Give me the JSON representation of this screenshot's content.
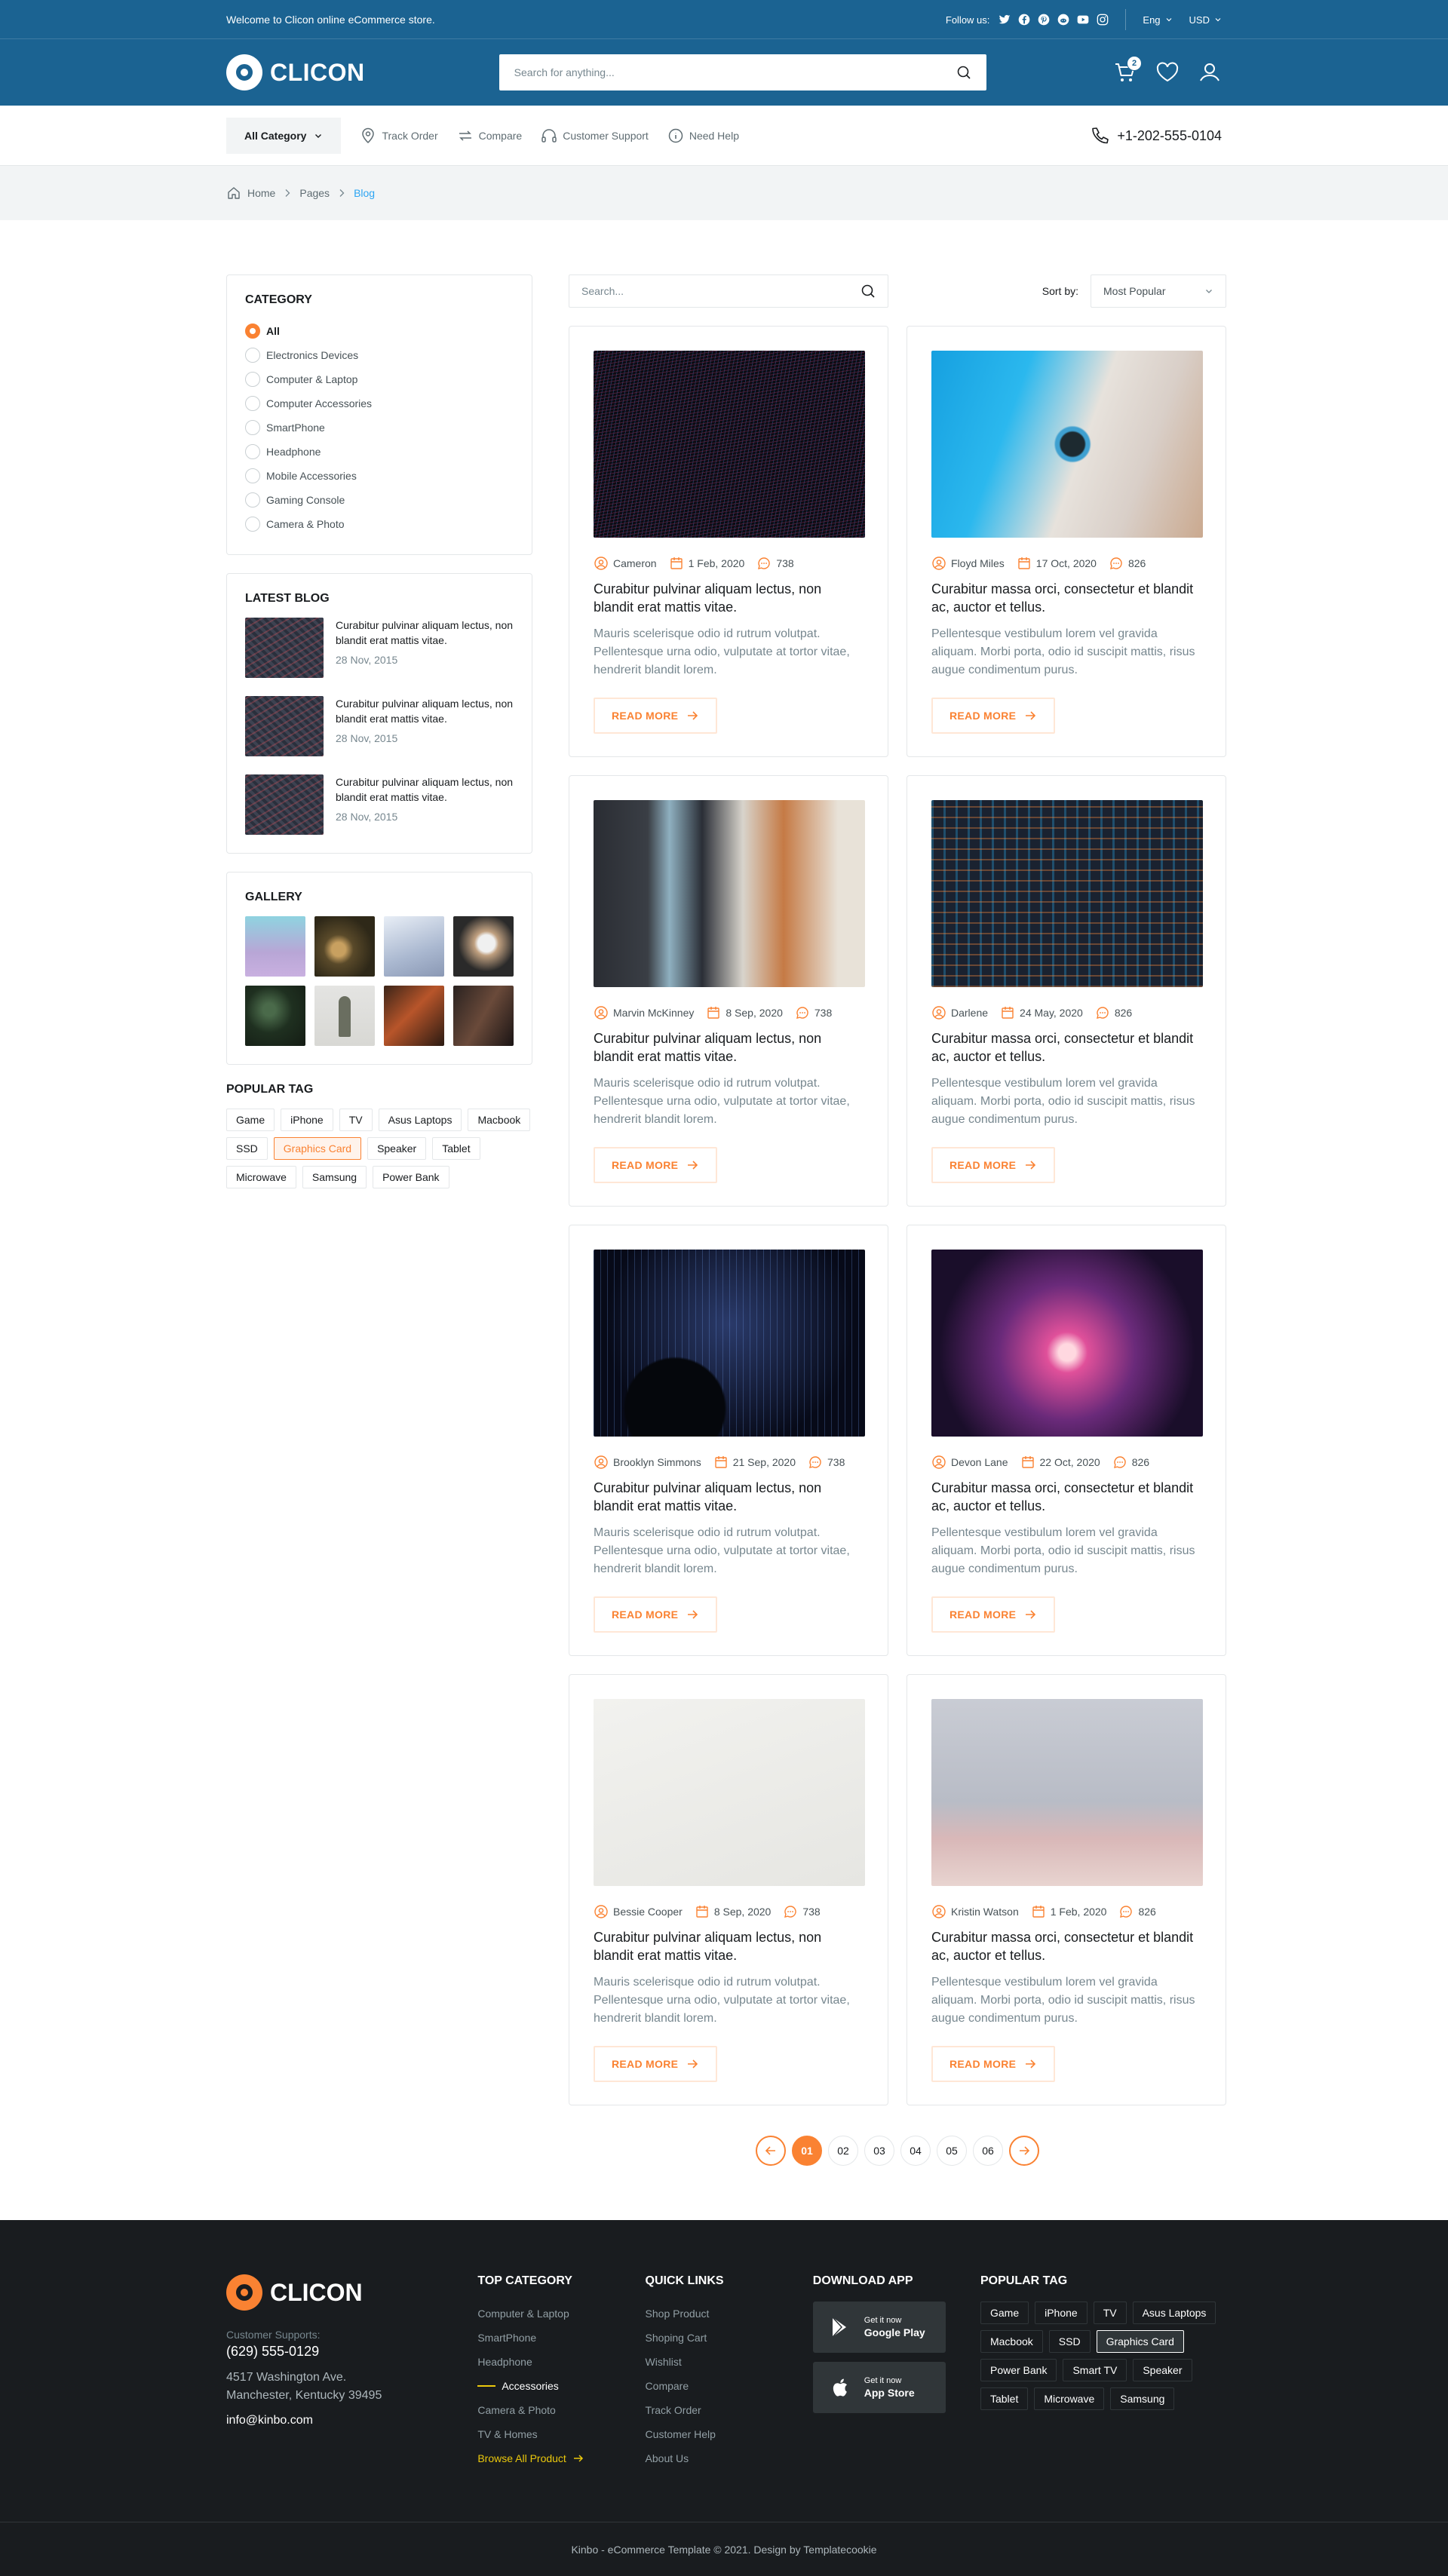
{
  "topbar": {
    "welcome": "Welcome to Clicon online eCommerce store.",
    "follow": "Follow us:",
    "social_icons": [
      "twitter-icon",
      "facebook-icon",
      "pinterest-icon",
      "reddit-icon",
      "youtube-icon",
      "instagram-icon"
    ],
    "language": "Eng",
    "currency": "USD"
  },
  "header": {
    "brand": "CLICON",
    "search_placeholder": "Search for anything...",
    "cart_count": "2"
  },
  "nav": {
    "all_category": "All Category",
    "items": [
      "Track Order",
      "Compare",
      "Customer Support",
      "Need Help"
    ],
    "phone": "+1-202-555-0104"
  },
  "breadcrumb": [
    "Home",
    "Pages",
    "Blog"
  ],
  "sidebar": {
    "category_title": "CATEGORY",
    "categories": [
      "All",
      "Electronics Devices",
      "Computer & Laptop",
      "Computer Accessories",
      "SmartPhone",
      "Headphone",
      "Mobile Accessories",
      "Gaming Console",
      "Camera & Photo"
    ],
    "selected_category": "All",
    "latest_title": "LATEST BLOG",
    "latest": [
      {
        "title": "Curabitur pulvinar aliquam lectus, non blandit erat mattis vitae.",
        "date": "28 Nov, 2015"
      },
      {
        "title": "Curabitur pulvinar aliquam lectus, non blandit erat mattis vitae.",
        "date": "28 Nov, 2015"
      },
      {
        "title": "Curabitur pulvinar aliquam lectus, non blandit erat mattis vitae.",
        "date": "28 Nov, 2015"
      }
    ],
    "gallery_title": "GALLERY",
    "tags_title": "POPULAR TAG",
    "tags": [
      "Game",
      "iPhone",
      "TV",
      "Asus Laptops",
      "Macbook",
      "SSD",
      "Graphics Card",
      "Speaker",
      "Tablet",
      "Microwave",
      "Samsung",
      "Power Bank"
    ],
    "active_tag": "Graphics Card"
  },
  "content": {
    "search_placeholder": "Search...",
    "sort_label": "Sort by:",
    "sort_value": "Most Popular",
    "read_more": "READ MORE",
    "posts": [
      {
        "author": "Cameron",
        "date": "1 Feb, 2020",
        "comments": "738",
        "title": "Curabitur pulvinar aliquam lectus, non blandit erat mattis vitae.",
        "desc": "Mauris scelerisque odio id rutrum volutpat. Pellentesque urna odio, vulputate at tortor vitae, hendrerit blandit lorem."
      },
      {
        "author": "Floyd Miles",
        "date": "17 Oct, 2020",
        "comments": "826",
        "title": "Curabitur massa orci, consectetur et blandit ac, auctor et tellus.",
        "desc": "Pellentesque vestibulum lorem vel gravida aliquam. Morbi porta, odio id suscipit mattis, risus augue condimentum purus."
      },
      {
        "author": "Marvin McKinney",
        "date": "8 Sep, 2020",
        "comments": "738",
        "title": "Curabitur pulvinar aliquam lectus, non blandit erat mattis vitae.",
        "desc": "Mauris scelerisque odio id rutrum volutpat. Pellentesque urna odio, vulputate at tortor vitae, hendrerit blandit lorem."
      },
      {
        "author": "Darlene",
        "date": "24 May, 2020",
        "comments": "826",
        "title": "Curabitur massa orci, consectetur et blandit ac, auctor et tellus.",
        "desc": "Pellentesque vestibulum lorem vel gravida aliquam. Morbi porta, odio id suscipit mattis, risus augue condimentum purus."
      },
      {
        "author": "Brooklyn Simmons",
        "date": "21 Sep, 2020",
        "comments": "738",
        "title": "Curabitur pulvinar aliquam lectus, non blandit erat mattis vitae.",
        "desc": "Mauris scelerisque odio id rutrum volutpat. Pellentesque urna odio, vulputate at tortor vitae, hendrerit blandit lorem."
      },
      {
        "author": "Devon Lane",
        "date": "22 Oct, 2020",
        "comments": "826",
        "title": "Curabitur massa orci, consectetur et blandit ac, auctor et tellus.",
        "desc": "Pellentesque vestibulum lorem vel gravida aliquam. Morbi porta, odio id suscipit mattis, risus augue condimentum purus."
      },
      {
        "author": "Bessie Cooper",
        "date": "8 Sep, 2020",
        "comments": "738",
        "title": "Curabitur pulvinar aliquam lectus, non blandit erat mattis vitae.",
        "desc": "Mauris scelerisque odio id rutrum volutpat. Pellentesque urna odio, vulputate at tortor vitae, hendrerit blandit lorem."
      },
      {
        "author": "Kristin Watson",
        "date": "1 Feb, 2020",
        "comments": "826",
        "title": "Curabitur massa orci, consectetur et blandit ac, auctor et tellus.",
        "desc": "Pellentesque vestibulum lorem vel gravida aliquam. Morbi porta, odio id suscipit mattis, risus augue condimentum purus."
      }
    ],
    "pages": [
      "01",
      "02",
      "03",
      "04",
      "05",
      "06"
    ],
    "current_page": "01"
  },
  "footer": {
    "brand": "CLICON",
    "support_label": "Customer Supports:",
    "phone": "(629) 555-0129",
    "address": "4517 Washington Ave. Manchester, Kentucky 39495",
    "email": "info@kinbo.com",
    "top_category_title": "TOP CATEGORY",
    "top_category": [
      "Computer & Laptop",
      "SmartPhone",
      "Headphone",
      "Accessories",
      "Camera & Photo",
      "TV & Homes"
    ],
    "active_category": "Accessories",
    "browse": "Browse All Product",
    "quick_links_title": "QUICK LINKS",
    "quick_links": [
      "Shop Product",
      "Shoping Cart",
      "Wishlist",
      "Compare",
      "Track Order",
      "Customer Help",
      "About Us"
    ],
    "download_title": "DOWNLOAD APP",
    "apps": [
      {
        "small": "Get it now",
        "name": "Google Play"
      },
      {
        "small": "Get it now",
        "name": "App Store"
      }
    ],
    "tags_title": "POPULAR TAG",
    "tags": [
      "Game",
      "iPhone",
      "TV",
      "Asus Laptops",
      "Macbook",
      "SSD",
      "Graphics Card",
      "Power Bank",
      "Smart TV",
      "Speaker",
      "Tablet",
      "Microwave",
      "Samsung"
    ],
    "active_tag": "Graphics Card",
    "copyright": "Kinbo - eCommerce Template © 2021. Design by Templatecookie"
  },
  "colors": {
    "primary": "#1B6392",
    "accent": "#FA8232",
    "footer": "#191C1F",
    "link": "#2DA5F3"
  }
}
